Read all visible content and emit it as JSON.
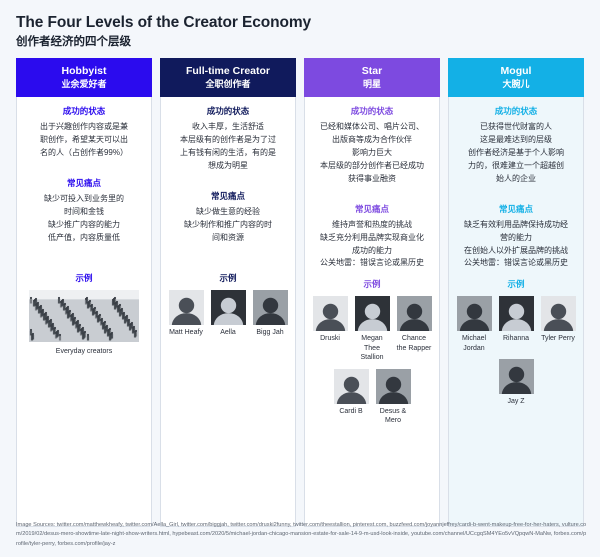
{
  "header": {
    "title_en": "The Four Levels of the Creator Economy",
    "title_zh": "创作者经济的四个层级"
  },
  "section_labels": {
    "success": "成功的状态",
    "pain": "常见痛点",
    "examples": "示例"
  },
  "colors": {
    "hobbyist": "#2b0bee",
    "fulltime": "#101a5c",
    "star": "#7d4ae0",
    "mogul": "#13b0e6",
    "page_bg": "#f4f7fb",
    "card_bg": "#ffffff",
    "mogul_card_bg": "#eef7fb"
  },
  "columns": [
    {
      "name": "hobbyist",
      "head_en": "Hobbyist",
      "head_zh": "业余爱好者",
      "head_color": "#2b0bee",
      "accent": "#2b0bee",
      "body_tinted": false,
      "success": [
        "出于兴趣创作内容或是兼",
        "职创作，希望某天可以出",
        "名的人（占创作者99%）"
      ],
      "pain": [
        "缺少可投入到业务里的",
        "时间和金钱",
        "缺少推广内容的能力",
        "低产值，内容质量低"
      ],
      "examples": [
        {
          "label": "Everyday creators",
          "wide": true,
          "kind": "crowd"
        }
      ]
    },
    {
      "name": "fulltime",
      "head_en": "Full-time Creator",
      "head_zh": "全职创作者",
      "head_color": "#101a5c",
      "accent": "#101a5c",
      "body_tinted": false,
      "success": [
        "收入丰厚，生活舒适",
        "本层级有的创作者是为了过",
        "上有钱有闲的生活，有的是",
        "想成为明星"
      ],
      "pain": [
        "缺少做生意的经验",
        "缺少制作和推广内容的时",
        "间和资源"
      ],
      "examples": [
        {
          "label": "Matt Heafy",
          "wide": false,
          "kind": "portrait-light"
        },
        {
          "label": "Aella",
          "wide": false,
          "kind": "portrait-dark"
        },
        {
          "label": "Bigg Jah",
          "wide": false,
          "kind": "portrait-mid"
        }
      ]
    },
    {
      "name": "star",
      "head_en": "Star",
      "head_zh": "明星",
      "head_color": "#7d4ae0",
      "accent": "#7d4ae0",
      "body_tinted": false,
      "success": [
        "已经和媒体公司、唱片公司、",
        "出版商等成为合作伙伴",
        "影响力巨大",
        "本层级的部分创作者已经成功",
        "获得事业融资"
      ],
      "pain": [
        "维持声誉和热度的挑战",
        "缺乏充分利用品牌实现商业化",
        "成功的能力",
        "公关地雷：错误言论或黑历史"
      ],
      "examples": [
        {
          "label": "Druski",
          "wide": false,
          "kind": "portrait-light"
        },
        {
          "label": "Megan Thee Stallion",
          "wide": false,
          "kind": "portrait-dark"
        },
        {
          "label": "Chance the Rapper",
          "wide": false,
          "kind": "portrait-mid"
        },
        {
          "label": "Cardi B",
          "wide": false,
          "kind": "portrait-light"
        },
        {
          "label": "Desus & Mero",
          "wide": false,
          "kind": "portrait-mid"
        }
      ]
    },
    {
      "name": "mogul",
      "head_en": "Mogul",
      "head_zh": "大腕儿",
      "head_color": "#13b0e6",
      "accent": "#13b0e6",
      "body_tinted": true,
      "success": [
        "已获得世代财富的人",
        "这是最难达到的层级",
        "创作者经济是基于个人影响",
        "力的，很难建立一个超越创",
        "始人的企业"
      ],
      "pain": [
        "缺乏有效利用品牌保持成功经",
        "营的能力",
        "在创始人以外扩展品牌的挑战",
        "公关地雷：错误言论或黑历史"
      ],
      "examples": [
        {
          "label": "Michael Jordan",
          "wide": false,
          "kind": "portrait-mid"
        },
        {
          "label": "Rihanna",
          "wide": false,
          "kind": "portrait-dark"
        },
        {
          "label": "Tyler Perry",
          "wide": false,
          "kind": "portrait-light"
        },
        {
          "label": "Jay Z",
          "wide": false,
          "kind": "portrait-mid"
        }
      ]
    }
  ],
  "sources": "Image Sources: twitter.com/matthewkheafy, twitter.com/Aella_Girl, twitter.com/biggjah, twitter.com/druski2funny, twitter.com/theestallion, pinterest.com, buzzfeed.com/joyannjeffrey/cardi-b-went-makeup-free-for-her-haters, vulture.com/2019/02/desus-mero-showtime-late-night-show-writers.html, hypebeast.com/2020/5/michael-jordan-chicago-mansion-estate-for-sale-14-9-m-usd-look-inside, youtube.com/channel/UCcgqSM4YEo5vVQpqwN-MaNw, forbes.com/profile/tyler-perry, forbes.com/profile/jay-z"
}
